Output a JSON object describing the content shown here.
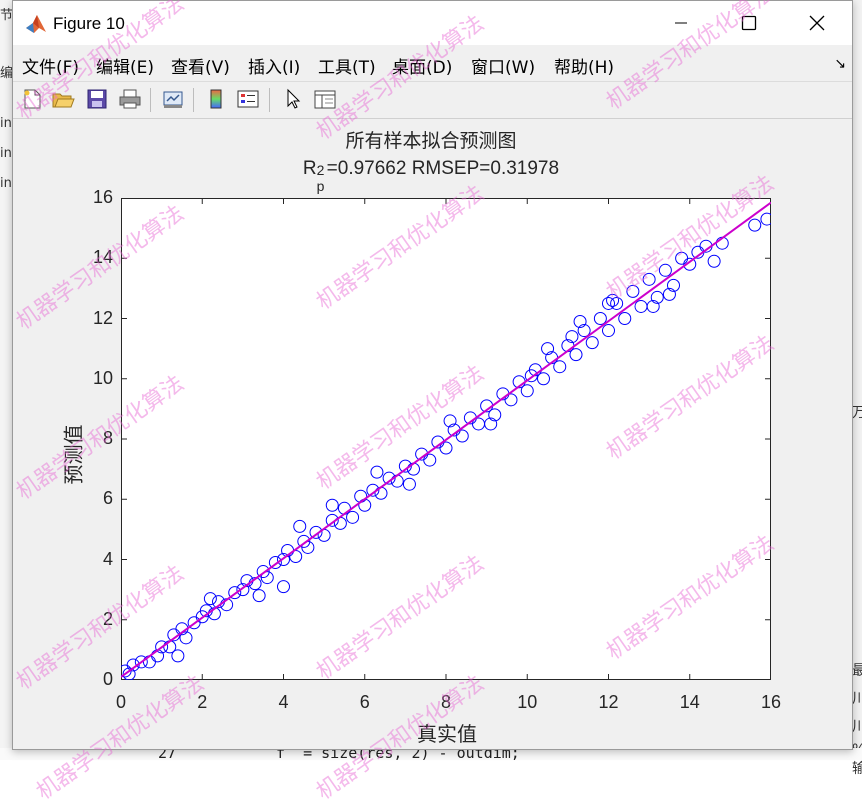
{
  "window": {
    "title": "Figure 10",
    "controls": {
      "minimize": "minimize",
      "maximize": "maximize",
      "close": "close"
    }
  },
  "menubar": {
    "items": [
      "文件(F)",
      "编辑(E)",
      "查看(V)",
      "插入(I)",
      "工具(T)",
      "桌面(D)",
      "窗口(W)",
      "帮助(H)"
    ],
    "overflow_glyph": "↘"
  },
  "toolbar": {
    "icons": [
      "new-figure-icon",
      "open-file-icon",
      "save-icon",
      "print-icon",
      "link-plot-icon",
      "insert-colorbar-icon",
      "insert-legend-icon",
      "edit-plot-arrow-icon",
      "property-inspector-icon"
    ]
  },
  "background": {
    "left_fragments": [
      "节",
      "编",
      "in",
      "in",
      "in"
    ],
    "right_fragments": [
      "万",
      "最",
      "川",
      "川",
      "% 输"
    ],
    "bottom_line_number": "27",
    "bottom_code": "f_ = size(res, 2) - outdim;"
  },
  "plot": {
    "title_line1": "所有样本拟合预测图",
    "title_line2_prefix": "R",
    "title_line2_sub": "p",
    "title_line2_sup": "2",
    "title_line2_rest": "=0.97662  RMSEP=0.31978",
    "xlabel": "真实值",
    "ylabel": "预测值",
    "xticks": [
      "0",
      "2",
      "4",
      "6",
      "8",
      "10",
      "12",
      "14",
      "16"
    ],
    "yticks": [
      "0",
      "2",
      "4",
      "6",
      "8",
      "10",
      "12",
      "14",
      "16"
    ]
  },
  "watermark": "机器学习和优化算法",
  "chart_data": {
    "type": "scatter",
    "xlim": [
      0,
      16
    ],
    "ylim": [
      0,
      16
    ],
    "grid": false,
    "marker": "open-circle",
    "marker_color": "#0000ff",
    "fit_line_color": "#cc00cc",
    "fit_line": {
      "x": [
        0,
        16
      ],
      "y": [
        0.1,
        15.85
      ]
    },
    "scatter": {
      "x": [
        0.1,
        0.2,
        0.3,
        0.5,
        0.7,
        0.9,
        1.0,
        1.2,
        1.3,
        1.5,
        1.6,
        1.8,
        2.0,
        2.1,
        2.3,
        2.4,
        2.6,
        2.8,
        3.0,
        3.1,
        3.3,
        3.5,
        3.6,
        3.8,
        4.0,
        4.1,
        4.3,
        4.5,
        4.6,
        4.8,
        5.0,
        5.2,
        5.4,
        5.5,
        5.7,
        5.9,
        6.0,
        6.2,
        6.4,
        6.6,
        6.8,
        7.0,
        7.2,
        7.4,
        7.6,
        7.8,
        8.0,
        8.2,
        8.4,
        8.6,
        8.8,
        9.0,
        9.2,
        9.4,
        9.6,
        9.8,
        10.0,
        10.2,
        10.4,
        10.6,
        10.8,
        11.0,
        11.2,
        11.4,
        11.6,
        11.8,
        12.0,
        12.2,
        12.4,
        12.6,
        12.8,
        13.0,
        13.2,
        13.4,
        13.6,
        13.8,
        14.0,
        14.2,
        14.4,
        14.6,
        14.8,
        15.6,
        15.9,
        1.4,
        2.2,
        3.4,
        4.4,
        5.2,
        6.3,
        7.1,
        8.1,
        9.1,
        10.1,
        11.1,
        12.1,
        13.1,
        4.0,
        11.3,
        10.5,
        12.0,
        13.5
      ],
      "y": [
        0.3,
        0.2,
        0.5,
        0.6,
        0.6,
        0.8,
        1.1,
        1.1,
        1.5,
        1.7,
        1.4,
        1.9,
        2.1,
        2.3,
        2.2,
        2.6,
        2.5,
        2.9,
        3.0,
        3.3,
        3.2,
        3.6,
        3.4,
        3.9,
        4.0,
        4.3,
        4.1,
        4.6,
        4.4,
        4.9,
        4.8,
        5.3,
        5.2,
        5.7,
        5.4,
        6.1,
        5.8,
        6.3,
        6.2,
        6.7,
        6.6,
        7.1,
        7.0,
        7.5,
        7.3,
        7.9,
        7.7,
        8.3,
        8.1,
        8.7,
        8.5,
        9.1,
        8.8,
        9.5,
        9.3,
        9.9,
        9.6,
        10.3,
        10.0,
        10.7,
        10.4,
        11.1,
        10.8,
        11.6,
        11.2,
        12.0,
        11.6,
        12.5,
        12.0,
        12.9,
        12.4,
        13.3,
        12.7,
        13.6,
        13.1,
        14.0,
        13.8,
        14.2,
        14.4,
        13.9,
        14.5,
        15.1,
        15.3,
        0.8,
        2.7,
        2.8,
        5.1,
        5.8,
        6.9,
        6.5,
        8.6,
        8.5,
        10.1,
        11.4,
        12.6,
        12.4,
        3.1,
        11.9,
        11.0,
        12.5,
        12.8
      ]
    }
  }
}
